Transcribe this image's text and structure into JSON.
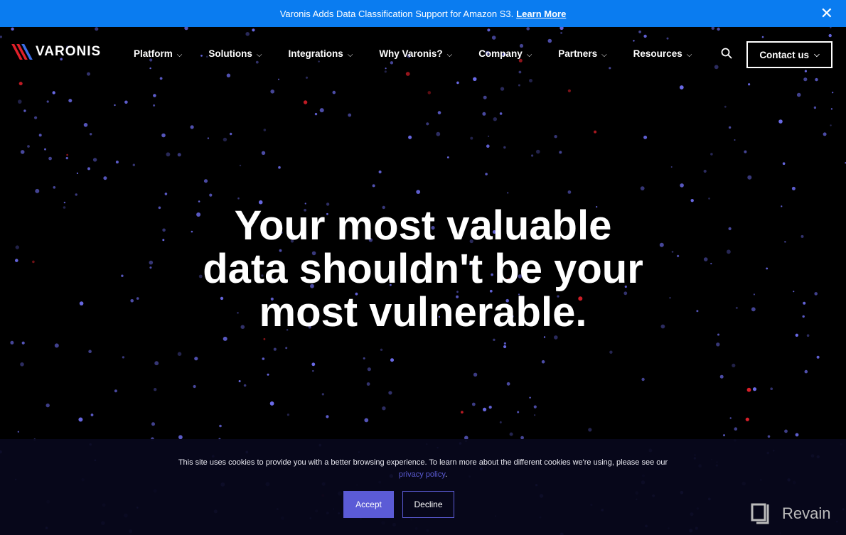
{
  "announcement": {
    "text": "Varonis Adds Data Classification Support for Amazon S3.",
    "link": "Learn More",
    "close_icon": "close-icon"
  },
  "nav": {
    "logo": "VARONIS",
    "items": [
      {
        "label": "Platform"
      },
      {
        "label": "Solutions"
      },
      {
        "label": "Integrations"
      },
      {
        "label": "Why Varonis?"
      },
      {
        "label": "Company"
      },
      {
        "label": "Partners"
      },
      {
        "label": "Resources"
      }
    ],
    "contact": "Contact us"
  },
  "hero": {
    "line1": "Your most valuable",
    "line2": "data shouldn't be your",
    "line3": "most vulnerable."
  },
  "cookie": {
    "text": "This site uses cookies to provide you with a better browsing experience. To learn more about the different cookies we're using, please see our",
    "link": "privacy policy",
    "period": ".",
    "accept": "Accept",
    "decline": "Decline"
  },
  "watermark": "Revain",
  "colors": {
    "banner": "#0a7cf0",
    "accent": "#5b5bd6",
    "dot_blue": "#6a6ae8",
    "dot_red": "#e0202a",
    "background": "#000000"
  }
}
